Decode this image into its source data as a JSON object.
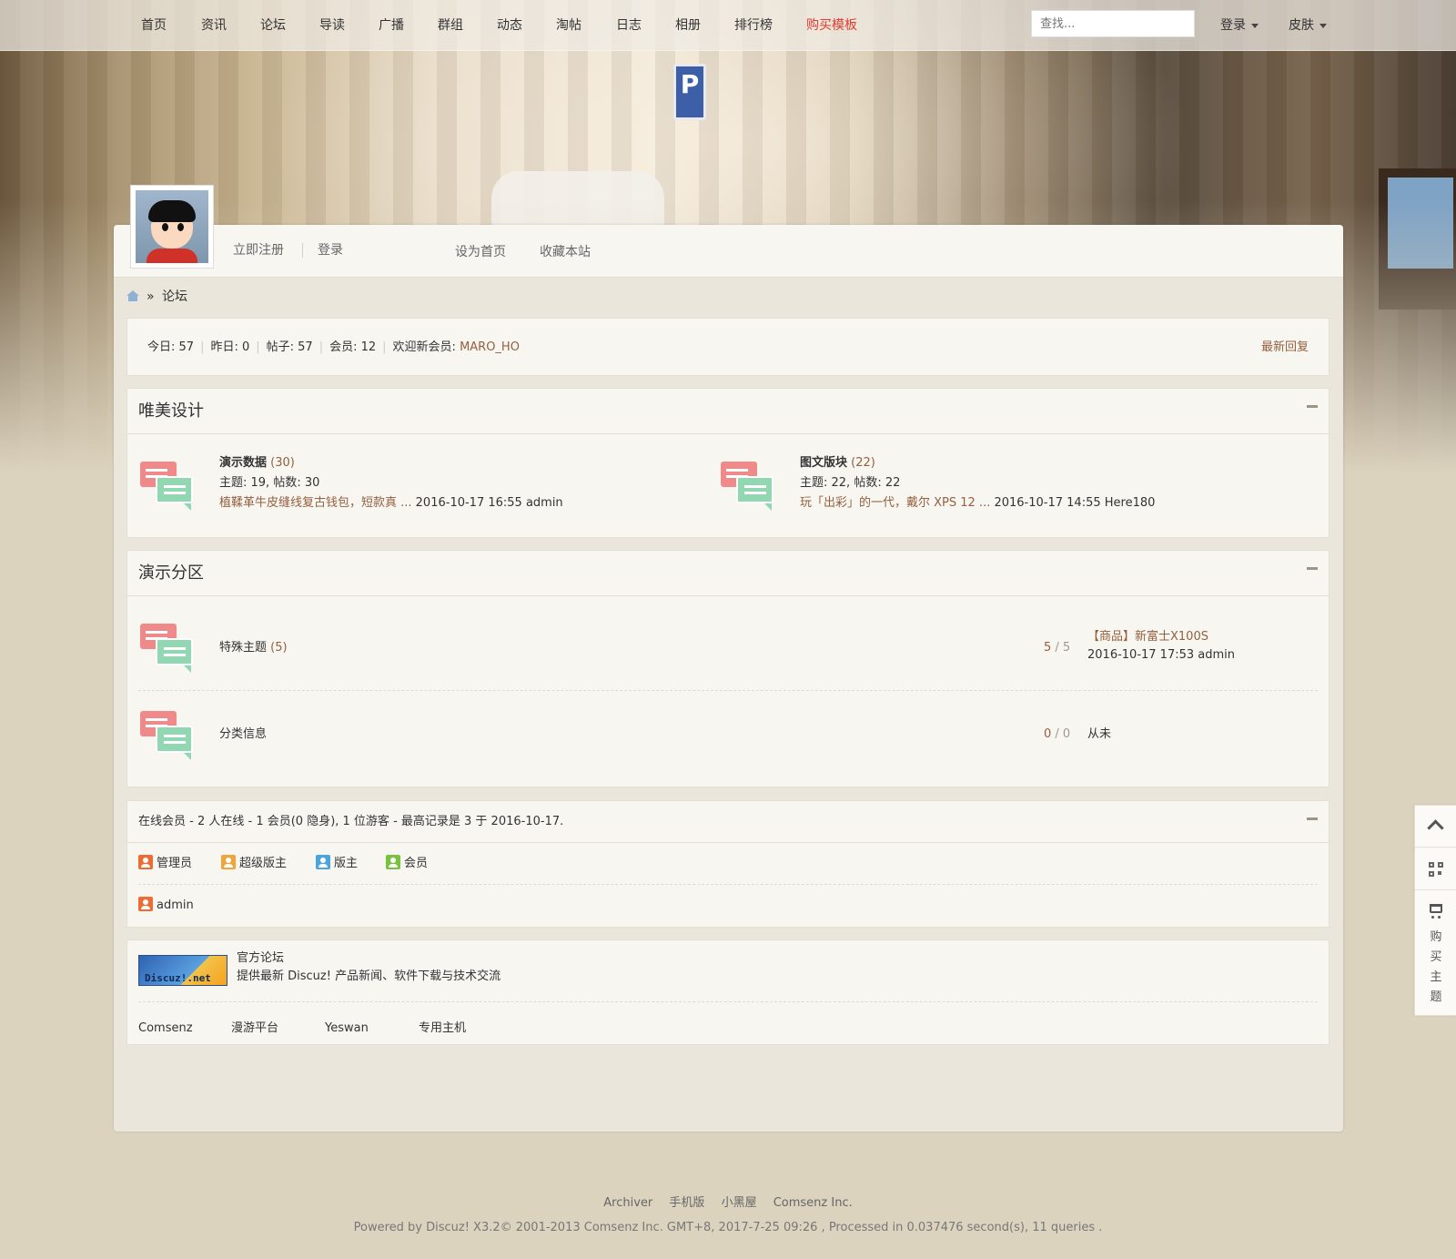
{
  "nav": {
    "items": [
      "首页",
      "资讯",
      "论坛",
      "导读",
      "广播",
      "群组",
      "动态",
      "淘帖",
      "日志",
      "相册",
      "排行榜",
      "购买模板"
    ],
    "highlight_index": 11,
    "highlight_color": "#e33a2f",
    "search_placeholder": "查找...",
    "login_label": "登录",
    "skin_label": "皮肤"
  },
  "userbar": {
    "register": "立即注册",
    "login": "登录",
    "set_home": "设为首页",
    "bookmark": "收藏本站"
  },
  "breadcrumb": {
    "sep": "»",
    "current": "论坛"
  },
  "stats": {
    "today_label": "今日: ",
    "today": "57",
    "yesterday_label": "昨日: ",
    "yesterday": "0",
    "posts_label": "帖子: ",
    "posts": "57",
    "members_label": "会员: ",
    "members": "12",
    "welcome_label": "欢迎新会员: ",
    "newest_member": "MARO_HO",
    "latest_replies": "最新回复"
  },
  "section1": {
    "title": "唯美设计",
    "forums": [
      {
        "name": "演示数据",
        "count": "(30)",
        "meta": "主题: 19, 帖数: 30",
        "last_title": "植鞣革牛皮缝线复古钱包，短款真 ...",
        "last_info": " 2016-10-17 16:55 admin"
      },
      {
        "name": "图文版块",
        "count": "(22)",
        "meta": "主题: 22, 帖数: 22",
        "last_title": "玩「出彩」的一代，戴尔 XPS 12 ...",
        "last_info": " 2016-10-17 14:55 Here180"
      }
    ]
  },
  "section2": {
    "title": "演示分区",
    "forums": [
      {
        "name": "特殊主题",
        "count": "(5)",
        "stats_a": "5",
        "stats_b": " / 5",
        "last_title": "【商品】新富士X100S",
        "last_info": "2016-10-17 17:53 admin"
      },
      {
        "name": "分类信息",
        "count": "",
        "stats_a": "0",
        "stats_b": " / 0",
        "last_title": "",
        "last_info": "从未"
      }
    ]
  },
  "online": {
    "summary": "在线会员 - 2 人在线 - 1 会员(0 隐身), 1 位游客 - 最高记录是 3 于 2016-10-17.",
    "legend": [
      "管理员",
      "超级版主",
      "版主",
      "会员"
    ],
    "users": [
      "admin"
    ]
  },
  "links": {
    "logo_text": "Discuz!.net",
    "official_title": "官方论坛",
    "official_desc": "提供最新 Discuz! 产品新闻、软件下载与技术交流",
    "partners": [
      "Comsenz",
      "漫游平台",
      "Yeswan",
      "专用主机"
    ]
  },
  "footer": {
    "links": [
      "Archiver",
      "手机版",
      "小黑屋",
      "Comsenz Inc."
    ],
    "copyright": "Powered by Discuz! X3.2© 2001-2013 Comsenz Inc. GMT+8, 2017-7-25 09:26 , Processed in 0.037476 second(s), 11 queries ."
  },
  "sidebar": {
    "buy_text": [
      "购",
      "买",
      "主",
      "题"
    ]
  },
  "colors": {
    "link_brown": "#94603f",
    "page_bg": "#dcd3bf",
    "panel_bg": "#f8f6f1"
  }
}
